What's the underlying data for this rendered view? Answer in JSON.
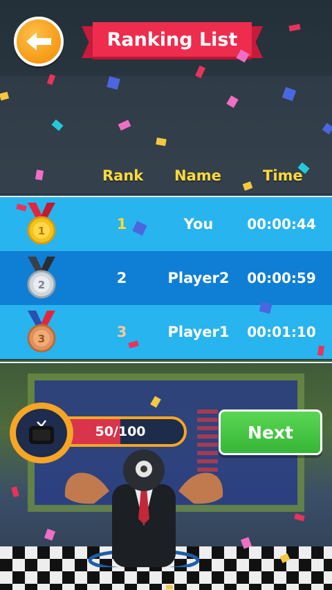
{
  "header": {
    "title": "Ranking List"
  },
  "table": {
    "headers": {
      "rank": "Rank",
      "name": "Name",
      "time": "Time"
    },
    "rows": [
      {
        "rank": "1",
        "name": "You",
        "time": "00:00:44",
        "medal": "gold-medal-icon",
        "rank_color": "#ffd93a"
      },
      {
        "rank": "2",
        "name": "Player2",
        "time": "00:00:59",
        "medal": "silver-medal-icon",
        "rank_color": "#ffffff"
      },
      {
        "rank": "3",
        "name": "Player1",
        "time": "00:01:10",
        "medal": "bronze-medal-icon",
        "rank_color": "#f3c99a"
      }
    ]
  },
  "progress": {
    "label": "50/100",
    "value": 50,
    "max": 100
  },
  "buttons": {
    "next_label": "Next",
    "back_icon": "back-arrow-icon"
  },
  "colors": {
    "header_text": "#ffd93a",
    "row_light": "#28b4ee",
    "row_dark": "#0f7fd5",
    "ribbon": "#ee2c4e",
    "next_button": "#44c544",
    "back_button": "#f7a525"
  }
}
